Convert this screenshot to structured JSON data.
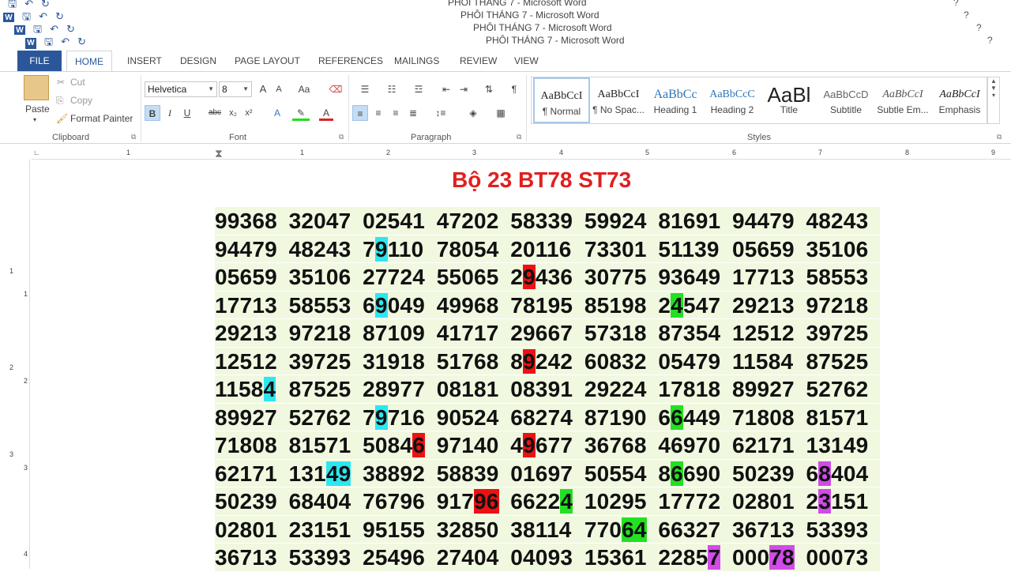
{
  "window": {
    "titles": [
      "PHÔI THÁNG 7 - Microsoft Word",
      "PHÔI THÁNG 7 - Microsoft Word",
      "PHÔI THÁNG 7 - Microsoft Word",
      "PHÔI THÁNG 7 - Microsoft Word"
    ],
    "help": "?"
  },
  "tabs": [
    "FILE",
    "HOME",
    "INSERT",
    "DESIGN",
    "PAGE LAYOUT",
    "REFERENCES",
    "MAILINGS",
    "REVIEW",
    "VIEW"
  ],
  "clipboard": {
    "label": "Clipboard",
    "paste": "Paste",
    "cut": "Cut",
    "copy": "Copy",
    "format_painter": "Format Painter"
  },
  "font": {
    "label": "Font",
    "family": "Helvetica",
    "size": "8",
    "bold": "B",
    "italic": "I",
    "underline": "U",
    "strike": "abc",
    "sub": "x₂",
    "sup": "x²",
    "grow": "A",
    "shrink": "A",
    "case": "Aa"
  },
  "paragraph": {
    "label": "Paragraph"
  },
  "styles": {
    "label": "Styles",
    "items": [
      {
        "preview": "AaBbCcI",
        "name": "¶ Normal"
      },
      {
        "preview": "AaBbCcI",
        "name": "¶ No Spac..."
      },
      {
        "preview": "AaBbCc",
        "name": "Heading 1"
      },
      {
        "preview": "AaBbCcC",
        "name": "Heading 2"
      },
      {
        "preview": "AaBl",
        "name": "Title"
      },
      {
        "preview": "AaBbCcD",
        "name": "Subtitle"
      },
      {
        "preview": "AaBbCcI",
        "name": "Subtle Em..."
      },
      {
        "preview": "AaBbCcI",
        "name": "Emphasis"
      }
    ]
  },
  "ruler": {
    "h_numbers": [
      "1",
      "1",
      "2",
      "3",
      "4",
      "5",
      "6",
      "7",
      "8",
      "9"
    ],
    "v_numbers": [
      "1",
      "1",
      "2",
      "2",
      "3",
      "3",
      "4"
    ]
  },
  "document": {
    "title": "Bộ 23 BT78  ST73",
    "rows": [
      [
        "99368",
        "32047",
        "02541",
        "47202",
        "58339",
        "59924",
        "81691",
        "94479",
        "48243"
      ],
      [
        "94479",
        "48243",
        "79110",
        "78054",
        "20116",
        "73301",
        "51139",
        "05659",
        "35106"
      ],
      [
        "05659",
        "35106",
        "27724",
        "55065",
        "29436",
        "30775",
        "93649",
        "17713",
        "58553"
      ],
      [
        "17713",
        "58553",
        "69049",
        "49968",
        "78195",
        "85198",
        "24547",
        "29213",
        "97218"
      ],
      [
        "29213",
        "97218",
        "87109",
        "41717",
        "29667",
        "57318",
        "87354",
        "12512",
        "39725"
      ],
      [
        "12512",
        "39725",
        "31918",
        "51768",
        "89242",
        "60832",
        "05479",
        "11584",
        "87525"
      ],
      [
        "11584",
        "87525",
        "28977",
        "08181",
        "08391",
        "29224",
        "17818",
        "89927",
        "52762"
      ],
      [
        "89927",
        "52762",
        "79716",
        "90524",
        "68274",
        "87190",
        "66449",
        "71808",
        "81571"
      ],
      [
        "71808",
        "81571",
        "50846",
        "97140",
        "49677",
        "36768",
        "46970",
        "62171",
        "13149"
      ],
      [
        "62171",
        "13149",
        "38892",
        "58839",
        "01697",
        "50554",
        "86690",
        "50239",
        "68404"
      ],
      [
        "50239",
        "68404",
        "76796",
        "91796",
        "66224",
        "10295",
        "17772",
        "02801",
        "23151"
      ],
      [
        "02801",
        "23151",
        "95155",
        "32850",
        "38114",
        "77064",
        "66327",
        "36713",
        "53393"
      ],
      [
        "36713",
        "53393",
        "25496",
        "27404",
        "04093",
        "15361",
        "22857",
        "00078",
        "00073"
      ]
    ],
    "highlights": [
      {
        "r": 1,
        "c": 2,
        "start": 1,
        "len": 1,
        "color": "cyan"
      },
      {
        "r": 2,
        "c": 4,
        "start": 1,
        "len": 1,
        "color": "red"
      },
      {
        "r": 3,
        "c": 2,
        "start": 1,
        "len": 1,
        "color": "cyan"
      },
      {
        "r": 3,
        "c": 6,
        "start": 1,
        "len": 1,
        "color": "green"
      },
      {
        "r": 5,
        "c": 4,
        "start": 1,
        "len": 1,
        "color": "red"
      },
      {
        "r": 6,
        "c": 0,
        "start": 4,
        "len": 1,
        "color": "cyan"
      },
      {
        "r": 7,
        "c": 2,
        "start": 1,
        "len": 1,
        "color": "cyan"
      },
      {
        "r": 7,
        "c": 6,
        "start": 1,
        "len": 1,
        "color": "green"
      },
      {
        "r": 8,
        "c": 2,
        "start": 4,
        "len": 1,
        "color": "red"
      },
      {
        "r": 8,
        "c": 4,
        "start": 1,
        "len": 1,
        "color": "red"
      },
      {
        "r": 9,
        "c": 1,
        "start": 3,
        "len": 2,
        "color": "cyan"
      },
      {
        "r": 9,
        "c": 6,
        "start": 1,
        "len": 1,
        "color": "green"
      },
      {
        "r": 9,
        "c": 8,
        "start": 1,
        "len": 1,
        "color": "mag"
      },
      {
        "r": 10,
        "c": 3,
        "start": 3,
        "len": 2,
        "color": "red"
      },
      {
        "r": 10,
        "c": 4,
        "start": 4,
        "len": 1,
        "color": "green"
      },
      {
        "r": 10,
        "c": 8,
        "start": 1,
        "len": 1,
        "color": "mag"
      },
      {
        "r": 11,
        "c": 5,
        "start": 3,
        "len": 2,
        "color": "green"
      },
      {
        "r": 12,
        "c": 6,
        "start": 4,
        "len": 1,
        "color": "mag"
      },
      {
        "r": 12,
        "c": 7,
        "start": 3,
        "len": 2,
        "color": "mag"
      }
    ]
  }
}
